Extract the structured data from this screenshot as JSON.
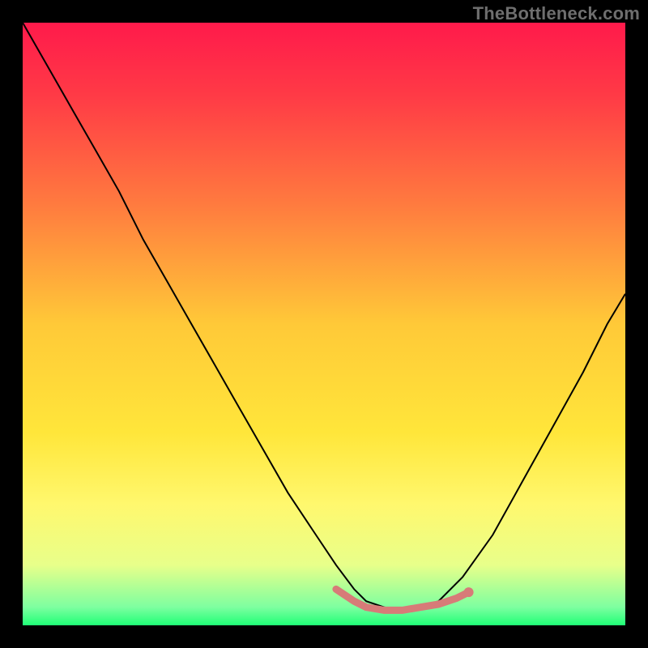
{
  "watermark": "TheBottleneck.com",
  "chart_data": {
    "type": "line",
    "title": "",
    "xlabel": "",
    "ylabel": "",
    "xlim": [
      0,
      100
    ],
    "ylim": [
      0,
      100
    ],
    "grid": false,
    "legend": false,
    "background_gradient": {
      "stops": [
        {
          "pos": 0.0,
          "color": "#ff1a4b"
        },
        {
          "pos": 0.12,
          "color": "#ff3a46"
        },
        {
          "pos": 0.3,
          "color": "#ff7a3f"
        },
        {
          "pos": 0.5,
          "color": "#ffc938"
        },
        {
          "pos": 0.68,
          "color": "#ffe63a"
        },
        {
          "pos": 0.8,
          "color": "#fff86e"
        },
        {
          "pos": 0.9,
          "color": "#e8ff8a"
        },
        {
          "pos": 0.97,
          "color": "#7dffa0"
        },
        {
          "pos": 1.0,
          "color": "#1fff76"
        }
      ]
    },
    "series": [
      {
        "name": "bottleneck-curve",
        "color": "#000000",
        "width": 2,
        "x": [
          0,
          4,
          8,
          12,
          16,
          20,
          24,
          28,
          32,
          36,
          40,
          44,
          48,
          52,
          55,
          57,
          60,
          63,
          66,
          69,
          73,
          78,
          83,
          88,
          93,
          97,
          100
        ],
        "y": [
          100,
          93,
          86,
          79,
          72,
          64,
          57,
          50,
          43,
          36,
          29,
          22,
          16,
          10,
          6,
          4,
          3,
          2.5,
          3,
          4,
          8,
          15,
          24,
          33,
          42,
          50,
          55
        ]
      },
      {
        "name": "optimal-band",
        "color": "#d77b78",
        "width": 9,
        "cap": "round",
        "x": [
          52,
          55,
          57,
          60,
          63,
          66,
          69,
          72,
          74
        ],
        "y": [
          6,
          4,
          3,
          2.5,
          2.5,
          3,
          3.5,
          4.5,
          5.5
        ]
      }
    ],
    "marker": {
      "name": "optimal-end-dot",
      "x": 74,
      "y": 5.5,
      "r": 6,
      "color": "#d77b78"
    }
  }
}
